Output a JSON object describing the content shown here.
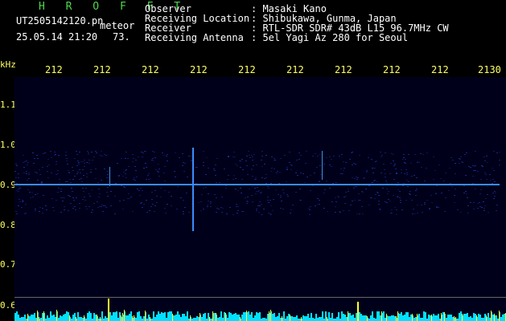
{
  "header": {
    "station": "H R O F F T",
    "filename": "UT2505142120.pn",
    "type_label": "meteor",
    "timestamp": "25.05.14 21:20",
    "count": "73.",
    "rows": [
      {
        "label": "Observer",
        "value": ": Masaki Kano"
      },
      {
        "label": "Receiving Location",
        "value": ": Shibukawa, Gunma, Japan"
      },
      {
        "label": "Receiver",
        "value": ": RTL-SDR SDR# 43dB L15 96.7MHz CW"
      },
      {
        "label": "Receiving Antenna",
        "value": ": 5el Yagi Az 280 for Seoul"
      }
    ]
  },
  "axis": {
    "y_unit": "kHz",
    "x_ticks": [
      "212",
      "212",
      "212",
      "212",
      "212",
      "212",
      "212",
      "212",
      "212",
      "2130"
    ],
    "y_ticks": [
      "1.1",
      "1.0",
      "0.9",
      "0.8",
      "0.7",
      "0.6"
    ]
  },
  "colors": {
    "header_green": "#4cd84c",
    "header_label": "#ffffff",
    "header_value": "#ffff66",
    "signal": "#3a8cff",
    "noise": "#1a2a9a",
    "bottom_bar_cyan": "#00e0ff",
    "bottom_bar_yellow": "#ffff33"
  }
}
